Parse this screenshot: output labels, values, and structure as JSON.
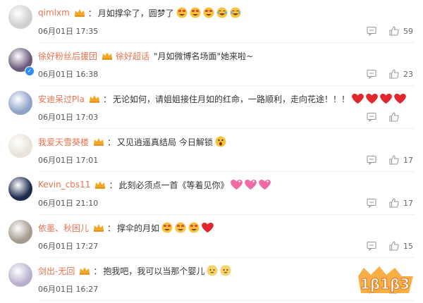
{
  "comments": [
    {
      "username": "qimlxm",
      "content": "月如撑伞了，圆梦了",
      "emojis": [
        "grin-emoji",
        "grin-emoji",
        "grin-emoji",
        "laugh-cry-emoji",
        "laugh-cry-emoji"
      ],
      "date": "06月01日 17:35",
      "likes": "59",
      "avatar_color": "#cfcfcf",
      "verified": false
    },
    {
      "username": "徐好粉丝后援团",
      "mention": "徐好超话",
      "quote": "\"月如微博名场面\"她来啦~",
      "content": "",
      "emojis": [],
      "date": "06月01日 16:38",
      "likes": "23",
      "avatar_color": "#6b5b7a",
      "verified": true
    },
    {
      "username": "安迪呆过Pla",
      "content": "无论如何，请姐姐接住月如的红命，一路顺利，走向花途！！！",
      "emojis": [
        "heart-emoji",
        "heart-emoji",
        "heart-emoji",
        "heart-emoji"
      ],
      "date": "06月01日 17:03",
      "likes": "",
      "avatar_color": "#8fa2c9",
      "verified": false
    },
    {
      "username": "我爱天雪葵楼",
      "content": "又见逍遥真结局 今日解锁",
      "emojis": [
        "surprised-emoji"
      ],
      "date": "06月01日 17:01",
      "likes": "17",
      "avatar_color": "#e8e2d8",
      "verified": false
    },
    {
      "username": "Kevin_cbs11",
      "content": "此刻必须点一首《等着见你》",
      "emojis": [
        "sparkle-heart-emoji",
        "sparkle-heart-emoji",
        "sparkle-heart-emoji"
      ],
      "date": "06月01日 21:10",
      "likes": "17",
      "avatar_color": "#1e2a4e",
      "verified": false
    },
    {
      "username": "依墨、秋困儿",
      "content": "撑伞的月如",
      "emojis": [
        "grin-emoji",
        "grin-emoji",
        "grin-emoji",
        "heart-emoji"
      ],
      "date": "06月01日 17:27",
      "likes": "15",
      "avatar_color": "#a49a8e",
      "verified": false
    },
    {
      "username": "剑出-无回",
      "content": "抱我吧，我可以当那个婴儿",
      "emojis": [
        "cat-emoji",
        "cat-emoji"
      ],
      "date": "06月01日 16:27",
      "likes": "",
      "avatar_color": "#b8b0cc",
      "verified": false
    }
  ],
  "watermark": {
    "text": "1β1β3",
    "color": "#f08a1c"
  },
  "colors": {
    "username": "#eb7350",
    "text": "#333333",
    "meta": "#555555"
  }
}
